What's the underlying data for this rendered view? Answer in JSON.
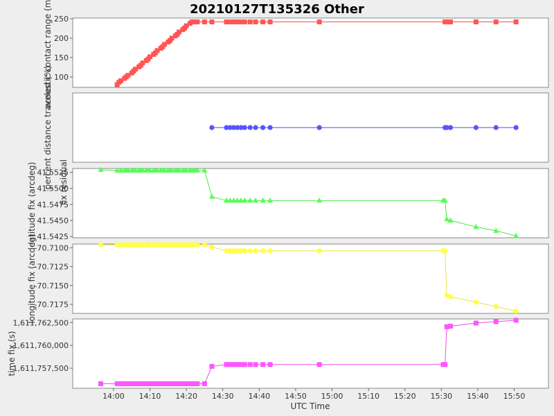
{
  "title": "20210127T135326 Other",
  "x_label": "UTC Time",
  "x_ticks": [
    "14:00",
    "14:10",
    "14:20",
    "14:30",
    "14:40",
    "14:50",
    "15:00",
    "15:10",
    "15:20",
    "15:30",
    "15:40",
    "15:50"
  ],
  "x_tick_minutes": [
    840,
    850,
    860,
    870,
    880,
    890,
    900,
    910,
    920,
    930,
    940,
    950
  ],
  "x_range_minutes": [
    828.8,
    959.4
  ],
  "chart_data": [
    {
      "type": "scatter",
      "ylabel": "acoustic contact range (m)",
      "color": "#ff5555",
      "marker": "square",
      "ylim": [
        73,
        252
      ],
      "yticks": [
        100,
        150,
        200,
        250
      ],
      "ytick_labels": [
        "100",
        "150",
        "200",
        "250"
      ],
      "x": [
        "14:01",
        "14:01.5",
        "14:02",
        "14:03",
        "14:03.5",
        "14:04",
        "14:05",
        "14:05.5",
        "14:06",
        "14:07",
        "14:07.5",
        "14:08",
        "14:09",
        "14:09.5",
        "14:10",
        "14:11",
        "14:11.5",
        "14:12",
        "14:13",
        "14:13.5",
        "14:14",
        "14:15",
        "14:15.5",
        "14:16",
        "14:17",
        "14:17.5",
        "14:18",
        "14:19",
        "14:19.5",
        "14:20",
        "14:21",
        "14:21.5",
        "14:22",
        "14:22.5",
        "14:23",
        "14:25",
        "14:27",
        "14:31",
        "14:32",
        "14:33",
        "14:34",
        "14:35",
        "14:36",
        "14:37.5",
        "14:39",
        "14:41",
        "14:43",
        "14:56.5",
        "15:31",
        "15:31.5",
        "15:32.5",
        "15:39.5",
        "15:45",
        "15:50.5"
      ],
      "values": [
        80,
        86,
        90,
        96,
        100,
        104,
        110,
        115,
        120,
        126,
        130,
        136,
        142,
        146,
        152,
        158,
        162,
        168,
        174,
        178,
        184,
        190,
        194,
        200,
        206,
        210,
        216,
        222,
        226,
        232,
        238,
        242,
        242,
        242,
        242,
        242,
        242,
        242,
        242,
        242,
        242,
        242,
        242,
        242,
        242,
        242,
        242,
        242,
        242,
        242,
        242,
        242,
        242,
        242
      ]
    },
    {
      "type": "scatter",
      "ylabel": "percent distance traveled (%)",
      "color": "#5555ff",
      "marker": "circle",
      "ylim": [
        0,
        100
      ],
      "yticks": [],
      "ytick_labels": [],
      "x": [
        "14:27",
        "14:31",
        "14:32",
        "14:33",
        "14:34",
        "14:35",
        "14:36",
        "14:37.5",
        "14:39",
        "14:41",
        "14:43",
        "14:56.5",
        "15:31",
        "15:31.5",
        "15:32.5",
        "15:39.5",
        "15:45",
        "15:50.5"
      ],
      "values": [
        50,
        50,
        50,
        50,
        50,
        50,
        50,
        50,
        50,
        50,
        50,
        50,
        50,
        50,
        50,
        50,
        50,
        50
      ]
    },
    {
      "type": "scatter",
      "ylabel": "latitude fix (arcdeg)",
      "overlaid_label": "fix residual",
      "color": "#55ff55",
      "marker": "triangle",
      "ylim": [
        41.5423,
        41.5531
      ],
      "yticks": [
        41.5425,
        41.545,
        41.5475,
        41.55,
        41.5525
      ],
      "ytick_labels": [
        "41.5425",
        "41.5450",
        "41.5475",
        "41.5500",
        "41.5525"
      ],
      "x": [
        "13:56.5",
        "14:01",
        "14:02",
        "14:03",
        "14:03.5",
        "14:04",
        "14:05",
        "14:05.5",
        "14:06",
        "14:07",
        "14:07.5",
        "14:08",
        "14:09",
        "14:09.5",
        "14:10",
        "14:11",
        "14:11.5",
        "14:12",
        "14:13",
        "14:13.5",
        "14:14",
        "14:15",
        "14:15.5",
        "14:16",
        "14:17",
        "14:17.5",
        "14:18",
        "14:19",
        "14:19.5",
        "14:20",
        "14:21",
        "14:21.5",
        "14:22",
        "14:22.5",
        "14:23",
        "14:25",
        "14:27",
        "14:31",
        "14:32",
        "14:33",
        "14:34",
        "14:35",
        "14:36",
        "14:37.5",
        "14:39",
        "14:41",
        "14:43",
        "14:56.5",
        "15:30.5",
        "15:31",
        "15:31.5",
        "15:32.5",
        "15:39.5",
        "15:45",
        "15:50.5"
      ],
      "values": [
        41.5529,
        41.5528,
        41.5528,
        41.5528,
        41.5528,
        41.5528,
        41.5528,
        41.5528,
        41.5528,
        41.5528,
        41.5528,
        41.5528,
        41.5528,
        41.5528,
        41.5528,
        41.5528,
        41.5528,
        41.5528,
        41.5528,
        41.5528,
        41.5528,
        41.5528,
        41.5528,
        41.5528,
        41.5528,
        41.5528,
        41.5528,
        41.5528,
        41.5528,
        41.5528,
        41.5528,
        41.5528,
        41.5528,
        41.5528,
        41.5528,
        41.5528,
        41.5487,
        41.5481,
        41.5481,
        41.5481,
        41.5481,
        41.5481,
        41.5481,
        41.5481,
        41.5481,
        41.5481,
        41.5481,
        41.5481,
        41.5481,
        41.5481,
        41.5452,
        41.545,
        41.544,
        41.5434,
        41.5426
      ]
    },
    {
      "type": "scatter",
      "ylabel": "longitude fix (arcdeg)",
      "color": "#ffff44",
      "marker": "circle",
      "ylim": [
        -70.7187,
        -70.7095
      ],
      "yticks": [
        -70.71,
        -70.7125,
        -70.715,
        -70.7175
      ],
      "ytick_labels": [
        "-70.7100",
        "-70.7125",
        "-70.7150",
        "-70.7175"
      ],
      "x": [
        "13:56.5",
        "14:01",
        "14:02",
        "14:03",
        "14:03.5",
        "14:04",
        "14:05",
        "14:05.5",
        "14:06",
        "14:07",
        "14:07.5",
        "14:08",
        "14:09",
        "14:09.5",
        "14:10",
        "14:11",
        "14:11.5",
        "14:12",
        "14:13",
        "14:13.5",
        "14:14",
        "14:15",
        "14:15.5",
        "14:16",
        "14:17",
        "14:17.5",
        "14:18",
        "14:19",
        "14:19.5",
        "14:20",
        "14:21",
        "14:21.5",
        "14:22",
        "14:22.5",
        "14:23",
        "14:25",
        "14:27",
        "14:31",
        "14:32",
        "14:33",
        "14:34",
        "14:35",
        "14:36",
        "14:37.5",
        "14:39",
        "14:41",
        "14:43",
        "14:56.5",
        "15:30.5",
        "15:31",
        "15:31.5",
        "15:32.5",
        "15:39.5",
        "15:45",
        "15:50.5"
      ],
      "values": [
        -70.7096,
        -70.7096,
        -70.7096,
        -70.7096,
        -70.7096,
        -70.7096,
        -70.7096,
        -70.7096,
        -70.7096,
        -70.7096,
        -70.7096,
        -70.7096,
        -70.7096,
        -70.7096,
        -70.7096,
        -70.7096,
        -70.7096,
        -70.7096,
        -70.7096,
        -70.7096,
        -70.7096,
        -70.7096,
        -70.7096,
        -70.7096,
        -70.7096,
        -70.7096,
        -70.7096,
        -70.7096,
        -70.7096,
        -70.7096,
        -70.7096,
        -70.7096,
        -70.7096,
        -70.7096,
        -70.7096,
        -70.7096,
        -70.7099,
        -70.7104,
        -70.7104,
        -70.7104,
        -70.7104,
        -70.7104,
        -70.7104,
        -70.7104,
        -70.7104,
        -70.7104,
        -70.7104,
        -70.7104,
        -70.7104,
        -70.7104,
        -70.7163,
        -70.7165,
        -70.7172,
        -70.7178,
        -70.7184
      ]
    },
    {
      "type": "scatter",
      "ylabel": "time fix (s)",
      "color": "#ff55ff",
      "marker": "square",
      "ylim": [
        1611755300,
        1611762900
      ],
      "yticks": [
        1611757500,
        1611760000,
        1611762500
      ],
      "ytick_labels": [
        "1,611,757,500",
        "1,611,760,000",
        "1,611,762,500"
      ],
      "x": [
        "13:56.5",
        "14:01",
        "14:02",
        "14:03",
        "14:03.5",
        "14:04",
        "14:05",
        "14:05.5",
        "14:06",
        "14:07",
        "14:07.5",
        "14:08",
        "14:09",
        "14:09.5",
        "14:10",
        "14:11",
        "14:11.5",
        "14:12",
        "14:13",
        "14:13.5",
        "14:14",
        "14:15",
        "14:15.5",
        "14:16",
        "14:17",
        "14:17.5",
        "14:18",
        "14:19",
        "14:19.5",
        "14:20",
        "14:21",
        "14:21.5",
        "14:22",
        "14:22.5",
        "14:23",
        "14:25",
        "14:27",
        "14:31",
        "14:32",
        "14:33",
        "14:34",
        "14:35",
        "14:36",
        "14:37.5",
        "14:39",
        "14:41",
        "14:43",
        "14:56.5",
        "15:30.5",
        "15:31",
        "15:31.5",
        "15:32.5",
        "15:39.5",
        "15:45",
        "15:50.5"
      ],
      "values": [
        1611755800,
        1611755800,
        1611755800,
        1611755800,
        1611755800,
        1611755800,
        1611755800,
        1611755800,
        1611755800,
        1611755800,
        1611755800,
        1611755800,
        1611755800,
        1611755800,
        1611755800,
        1611755800,
        1611755800,
        1611755800,
        1611755800,
        1611755800,
        1611755800,
        1611755800,
        1611755800,
        1611755800,
        1611755800,
        1611755800,
        1611755800,
        1611755800,
        1611755800,
        1611755800,
        1611755800,
        1611755800,
        1611755800,
        1611755800,
        1611755800,
        1611755800,
        1611757700,
        1611757900,
        1611757900,
        1611757900,
        1611757900,
        1611757900,
        1611757900,
        1611757900,
        1611757900,
        1611757900,
        1611757900,
        1611757900,
        1611757900,
        1611757900,
        1611762050,
        1611762100,
        1611762450,
        1611762600,
        1611762750
      ]
    }
  ]
}
